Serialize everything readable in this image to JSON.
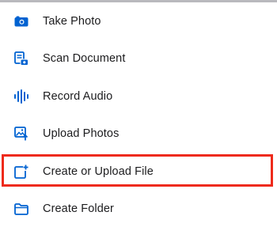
{
  "menu": {
    "items": [
      {
        "label": "Take Photo",
        "icon": "camera-icon"
      },
      {
        "label": "Scan Document",
        "icon": "scan-document-icon"
      },
      {
        "label": "Record Audio",
        "icon": "audio-waveform-icon"
      },
      {
        "label": "Upload Photos",
        "icon": "upload-photo-icon"
      },
      {
        "label": "Create or Upload File",
        "icon": "new-file-icon"
      },
      {
        "label": "Create Folder",
        "icon": "folder-icon"
      }
    ]
  },
  "colors": {
    "icon": "#0062d1",
    "text": "#1c1c1e",
    "highlight": "#ee2a1b",
    "divider": "#b9b9bd"
  }
}
